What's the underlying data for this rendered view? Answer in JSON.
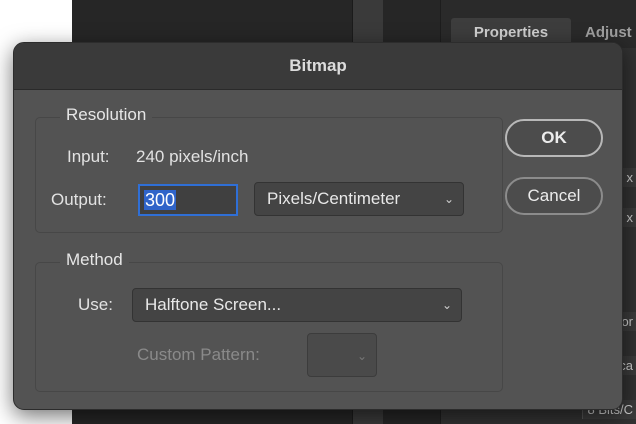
{
  "background_app": {
    "panel_tabs": [
      "Properties",
      "Adjust"
    ],
    "panel_fragments": [
      "x",
      "x",
      "or",
      "ca",
      "8 Bits/C"
    ]
  },
  "dialog": {
    "title": "Bitmap",
    "resolution": {
      "title": "Resolution",
      "input_label": "Input:",
      "input_value": "240 pixels/inch",
      "output_label": "Output:",
      "output_value": "300",
      "output_unit": "Pixels/Centimeter"
    },
    "method": {
      "title": "Method",
      "use_label": "Use:",
      "use_value": "Halftone Screen...",
      "custom_pattern_label": "Custom Pattern:"
    },
    "buttons": {
      "ok": "OK",
      "cancel": "Cancel"
    }
  }
}
